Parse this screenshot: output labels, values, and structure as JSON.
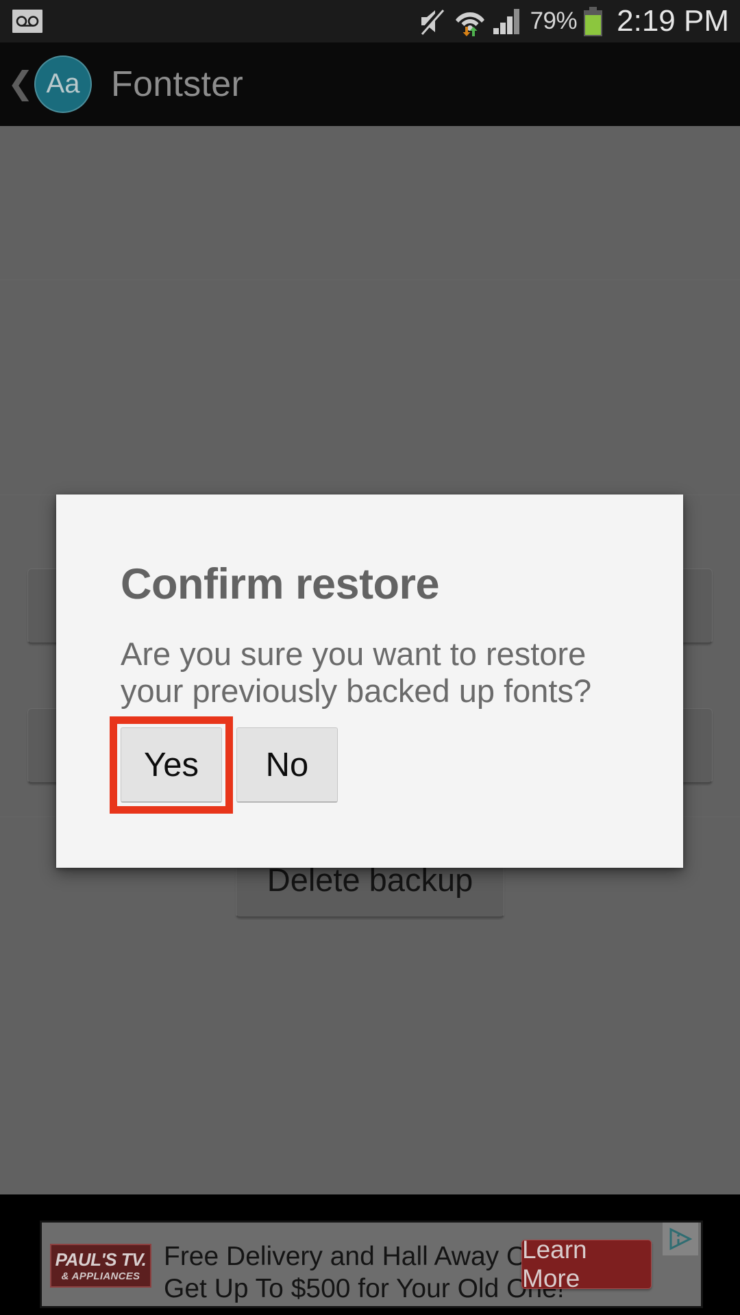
{
  "status_bar": {
    "voicemail_icon": "voicemail-icon",
    "mute_icon": "volume-mute-icon",
    "wifi_icon": "wifi-signal-icon",
    "signal_icon": "cellular-signal-icon",
    "battery_icon": "battery-icon",
    "battery_percent": "79%",
    "clock": "2:19 PM"
  },
  "action_bar": {
    "back_icon": "❮",
    "app_icon_label": "Aa",
    "title": "Fontster"
  },
  "background": {
    "delete_backup_label": "Delete backup"
  },
  "dialog": {
    "title": "Confirm restore",
    "message": "Are you sure you want to restore your previously backed up fonts?",
    "yes_label": "Yes",
    "no_label": "No",
    "highlight_color": "#e8351a"
  },
  "ad": {
    "logo_line1": "PAUL'S TV.",
    "logo_line2": "& APPLIANCES",
    "headline_line1": "Free Delivery and Hall Away Only",
    "headline_line2": "Get Up To $500 for Your Old One!",
    "cta_label": "Learn More",
    "adchoices_icon": "adchoices-icon"
  }
}
